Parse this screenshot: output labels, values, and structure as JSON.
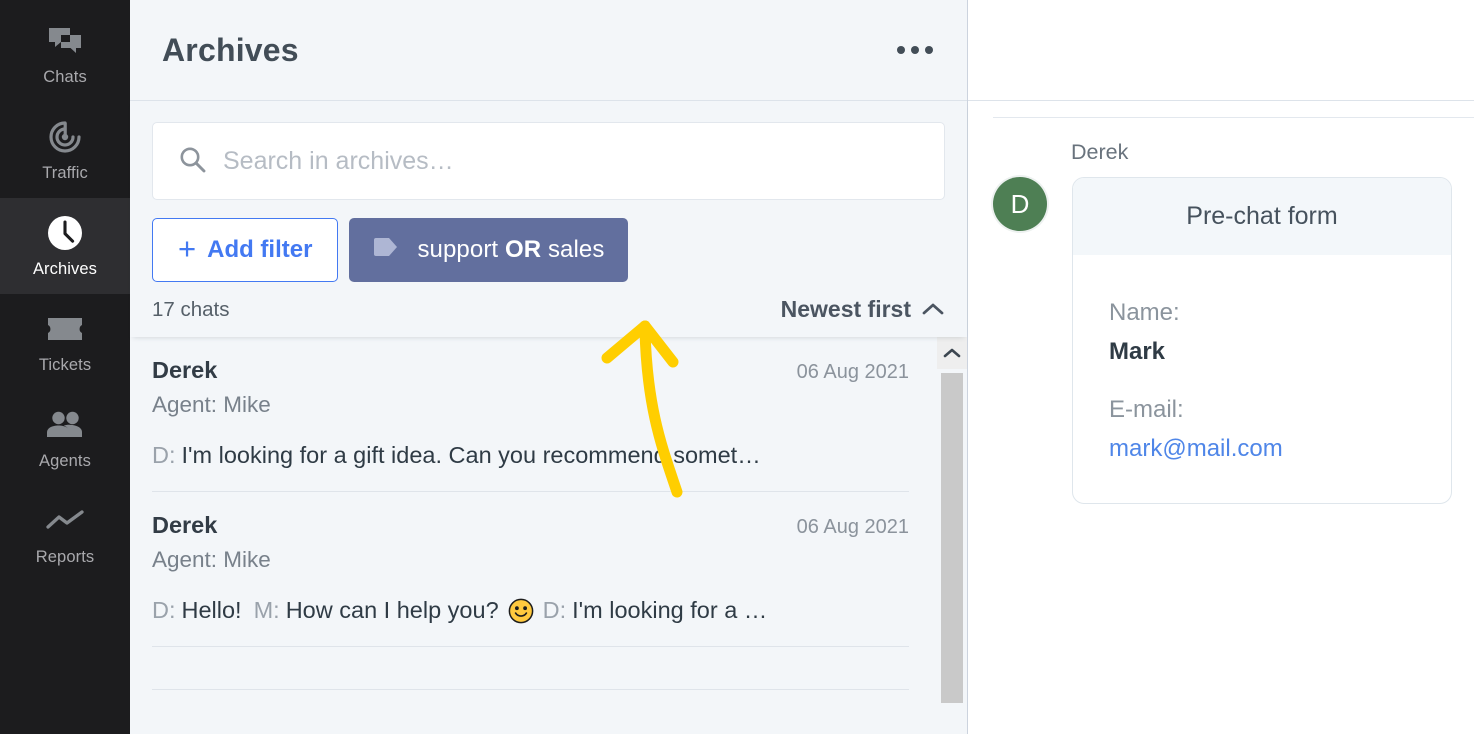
{
  "sidebar": {
    "items": [
      {
        "label": "Chats",
        "icon": "chats-icon",
        "active": false
      },
      {
        "label": "Traffic",
        "icon": "traffic-icon",
        "active": false
      },
      {
        "label": "Archives",
        "icon": "clock-icon",
        "active": true
      },
      {
        "label": "Tickets",
        "icon": "ticket-icon",
        "active": false
      },
      {
        "label": "Agents",
        "icon": "people-icon",
        "active": false
      },
      {
        "label": "Reports",
        "icon": "chart-line-icon",
        "active": false
      }
    ]
  },
  "header": {
    "title": "Archives",
    "more_menu": "more-options"
  },
  "search": {
    "placeholder": "Search in archives…",
    "value": ""
  },
  "filters": {
    "add_filter_label": "Add filter",
    "plus": "+",
    "active_tag": {
      "prefix": "support ",
      "operator": "OR",
      "suffix": " sales",
      "full_text": "support OR sales",
      "background": "#626f9e"
    }
  },
  "list_meta": {
    "count_label": "17 chats",
    "sort_label": "Newest first",
    "sort_direction": "asc"
  },
  "chats": [
    {
      "name": "Derek",
      "date": "06 Aug 2021",
      "agent_line": "Agent: Mike",
      "preview_who": "D:",
      "preview_text": "I'm looking for a gift idea. Can you recommend somet…",
      "has_emoji": false
    },
    {
      "name": "Derek",
      "date": "06 Aug 2021",
      "agent_line": "Agent: Mike",
      "preview_who": "D:",
      "preview_text": "Hello!",
      "preview_who2": "M:",
      "preview_text2": "How can I help you?",
      "has_emoji": true,
      "preview_who3": "D:",
      "preview_text3": "I'm looking for a …"
    }
  ],
  "conversation": {
    "author": "Derek",
    "avatar_initial": "D",
    "avatar_color": "#4e7f54",
    "prechat": {
      "title": "Pre-chat form",
      "fields": [
        {
          "label": "Name:",
          "value": "Mark",
          "is_link": false
        },
        {
          "label": "E-mail:",
          "value": "mark@mail.com",
          "is_link": true
        }
      ]
    }
  },
  "annotation": {
    "type": "curved-arrow",
    "color": "#FFCE00",
    "points_to": "active_tag_filter"
  },
  "theme": {
    "sidebar_bg": "#1c1c1e",
    "sidebar_active_bg": "#2e2e31",
    "panel_bg": "#f3f6f9",
    "accent_blue": "#4379f2",
    "link_blue": "#4f86e8",
    "text_dark": "#2f3b45",
    "text_muted": "#8b939c"
  }
}
